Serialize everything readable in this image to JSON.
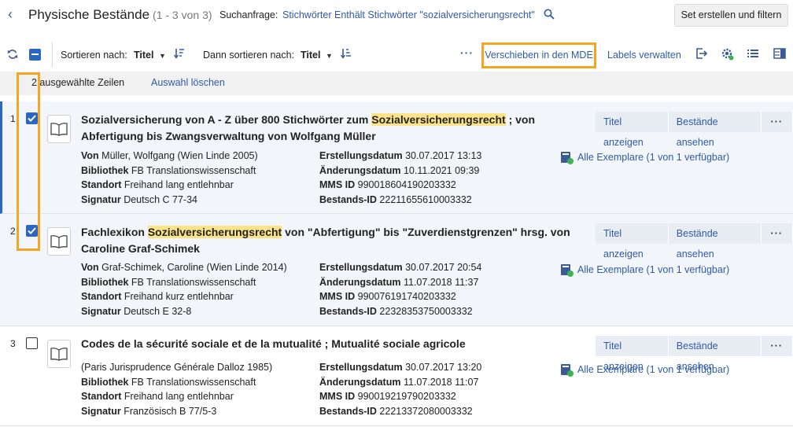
{
  "header": {
    "title": "Physische Bestände",
    "count": "(1 - 3 von 3)",
    "query_label": "Suchanfrage:",
    "query_value": "Stichwörter Enthält Stichwörter \"sozialversicherungsrecht\"",
    "set_button": "Set erstellen und filtern"
  },
  "toolbar": {
    "sort_label": "Sortieren nach:",
    "sort_value": "Titel",
    "then_label": "Dann sortieren nach:",
    "then_value": "Titel",
    "more": "···",
    "move_mde": "Verschieben in den MDE",
    "labels": "Labels verwalten"
  },
  "selection": {
    "count_text": "2 ausgewählte Zeilen",
    "clear": "Auswahl löschen"
  },
  "rows": [
    {
      "num": "1",
      "selected": true,
      "title_pre": "Sozialversicherung von A - Z über 800 Stichwörter zum ",
      "title_hl": "Sozialversicherungsrecht",
      "title_post": " ; von Abfertigung bis Zwangsverwaltung von Wolfgang Müller",
      "author_label": "Von",
      "author": "Müller, Wolfgang (Wien Linde 2005)",
      "library_label": "Bibliothek",
      "library": "FB Translationswissenschaft",
      "location_label": "Standort",
      "location": "Freihand lang entlehnbar",
      "callno_label": "Signatur",
      "callno": "Deutsch C 77-34",
      "created_label": "Erstellungsdatum",
      "created": "30.07.2017 13:13",
      "modified_label": "Änderungsdatum",
      "modified": "10.11.2021 09:39",
      "mms_label": "MMS ID",
      "mms": "990018604190203332",
      "holding_label": "Bestands-ID",
      "holding": "22211655610003332",
      "avail": "Alle Exemplare (1 von 1 verfügbar)",
      "btn_title": "Titel anzeigen",
      "btn_holdings": "Bestände ansehen",
      "btn_more": "···"
    },
    {
      "num": "2",
      "selected": true,
      "title_pre": "Fachlexikon ",
      "title_hl": "Sozialversicherungsrecht",
      "title_post": " von \"Abfertigung\" bis \"Zuverdienstgrenzen\" hrsg. von Caroline Graf-Schimek",
      "author_label": "Von",
      "author": "Graf-Schimek, Caroline (Wien Linde 2014)",
      "library_label": "Bibliothek",
      "library": "FB Translationswissenschaft",
      "location_label": "Standort",
      "location": "Freihand kurz entlehnbar",
      "callno_label": "Signatur",
      "callno": "Deutsch E 32-8",
      "created_label": "Erstellungsdatum",
      "created": "30.07.2017 20:54",
      "modified_label": "Änderungsdatum",
      "modified": "11.07.2018 11:37",
      "mms_label": "MMS ID",
      "mms": "990076191740203332",
      "holding_label": "Bestands-ID",
      "holding": "22328353750003332",
      "avail": "Alle Exemplare (1 von 1 verfügbar)",
      "btn_title": "Titel anzeigen",
      "btn_holdings": "Bestände ansehen",
      "btn_more": "···"
    },
    {
      "num": "3",
      "selected": false,
      "title_pre": "Codes de la sécurité sociale et de la mutualité ; Mutualité sociale agricole",
      "title_hl": "",
      "title_post": "",
      "author_label": "",
      "author": "(Paris Jurisprudence Générale Dalloz 1985)",
      "library_label": "Bibliothek",
      "library": "FB Translationswissenschaft",
      "location_label": "Standort",
      "location": "Freihand lang entlehnbar",
      "callno_label": "Signatur",
      "callno": "Französisch B 77/5-3",
      "created_label": "Erstellungsdatum",
      "created": "30.07.2017 13:20",
      "modified_label": "Änderungsdatum",
      "modified": "11.07.2018 11:07",
      "mms_label": "MMS ID",
      "mms": "990019219790203332",
      "holding_label": "Bestands-ID",
      "holding": "22213372080003332",
      "avail": "Alle Exemplare (1 von 1 verfügbar)",
      "btn_title": "Titel anzeigen",
      "btn_holdings": "Bestände ansehen",
      "btn_more": "···"
    }
  ],
  "colors": {
    "accent": "#2b66c4",
    "link": "#2f5aa8",
    "highlight": "#fbe38a",
    "callout": "#f4a623"
  }
}
